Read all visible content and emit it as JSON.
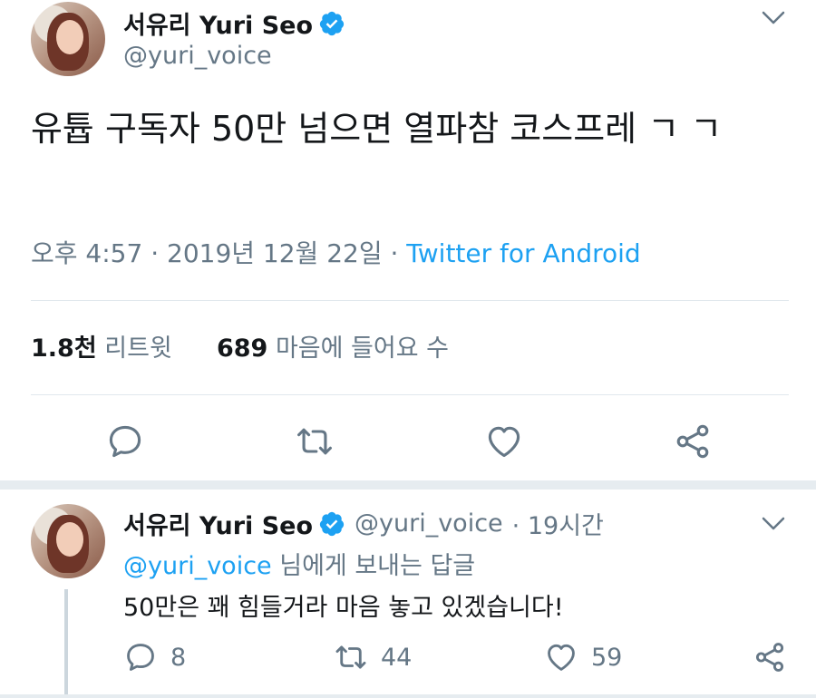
{
  "main_tweet": {
    "display_name": "서유리 Yuri Seo",
    "handle": "@yuri_voice",
    "text": "유튭 구독자 50만 넘으면 열파참 코스프레 ㄱ ㄱ",
    "time": "오후 4:57 · 2019년 12월 22일 · ",
    "source": "Twitter for Android",
    "retweet_count": "1.8천",
    "retweet_label": "리트윗",
    "like_count": "689",
    "like_label": "마음에 들어요 수",
    "icons": [
      "reply-icon",
      "retweet-icon",
      "like-icon",
      "share-icon",
      "verified-icon",
      "chevron-down-icon"
    ]
  },
  "reply_tweet": {
    "display_name": "서유리 Yuri Seo",
    "handle": "@yuri_voice",
    "time": "· 19시간",
    "reply_to_mention": "@yuri_voice",
    "reply_to_suffix": " 님에게 보내는 답글",
    "text": "50만은 꽤 힘들거라 마음 놓고 있겠습니다!",
    "reply_count": "8",
    "retweet_count": "44",
    "like_count": "59"
  },
  "colors": {
    "accent": "#1da1f2",
    "secondary_text": "#657786",
    "divider": "#e1e8ed"
  }
}
